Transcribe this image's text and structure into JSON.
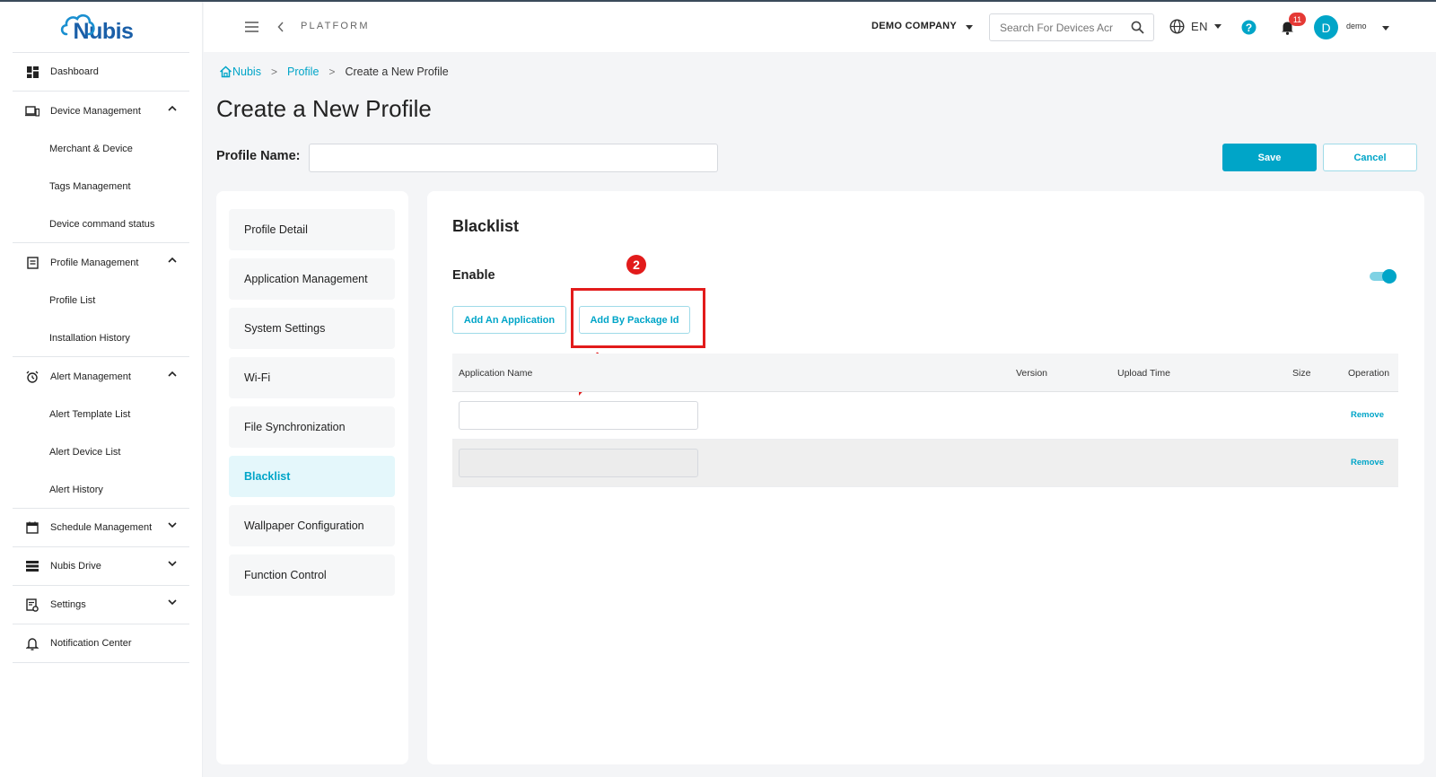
{
  "brand": {
    "logo_text": "Nubis"
  },
  "sidebar": {
    "items": [
      {
        "label": "Dashboard"
      },
      {
        "label": "Device Management"
      },
      {
        "label": "Merchant & Device"
      },
      {
        "label": "Tags Management"
      },
      {
        "label": "Device command status"
      },
      {
        "label": "Profile Management"
      },
      {
        "label": "Profile List"
      },
      {
        "label": "Installation History"
      },
      {
        "label": "Alert Management"
      },
      {
        "label": "Alert Template List"
      },
      {
        "label": "Alert Device List"
      },
      {
        "label": "Alert History"
      },
      {
        "label": "Schedule Management"
      },
      {
        "label": "Nubis Drive"
      },
      {
        "label": "Settings"
      },
      {
        "label": "Notification Center"
      }
    ]
  },
  "header": {
    "platform_label": "PLATFORM",
    "company": "DEMO COMPANY",
    "search_placeholder": "Search For Devices Acr",
    "language": "EN",
    "notification_count": "11",
    "avatar_initial": "D",
    "username": "demo"
  },
  "breadcrumb": {
    "home": "Nubis",
    "profile": "Profile",
    "current": "Create a New Profile"
  },
  "page": {
    "title": "Create a New Profile",
    "profile_name_label": "Profile Name:",
    "profile_name_value": "",
    "save_label": "Save",
    "cancel_label": "Cancel"
  },
  "tabs": [
    {
      "label": "Profile Detail"
    },
    {
      "label": "Application Management"
    },
    {
      "label": "System Settings"
    },
    {
      "label": "Wi-Fi"
    },
    {
      "label": "File Synchronization"
    },
    {
      "label": "Blacklist"
    },
    {
      "label": "Wallpaper Configuration"
    },
    {
      "label": "Function Control"
    }
  ],
  "blacklist": {
    "title": "Blacklist",
    "enable_label": "Enable",
    "enabled": true,
    "add_application_label": "Add An Application",
    "add_package_label": "Add By Package Id",
    "step_marker": "2",
    "columns": {
      "name": "Application Name",
      "version": "Version",
      "upload_time": "Upload Time",
      "size": "Size",
      "operation": "Operation"
    },
    "rows": [
      {
        "name_value": "",
        "action": "Remove"
      },
      {
        "name_value": "",
        "action": "Remove"
      }
    ]
  },
  "colors": {
    "accent": "#00a5c8",
    "annotation": "#e21b1b",
    "badge": "#e53935"
  }
}
